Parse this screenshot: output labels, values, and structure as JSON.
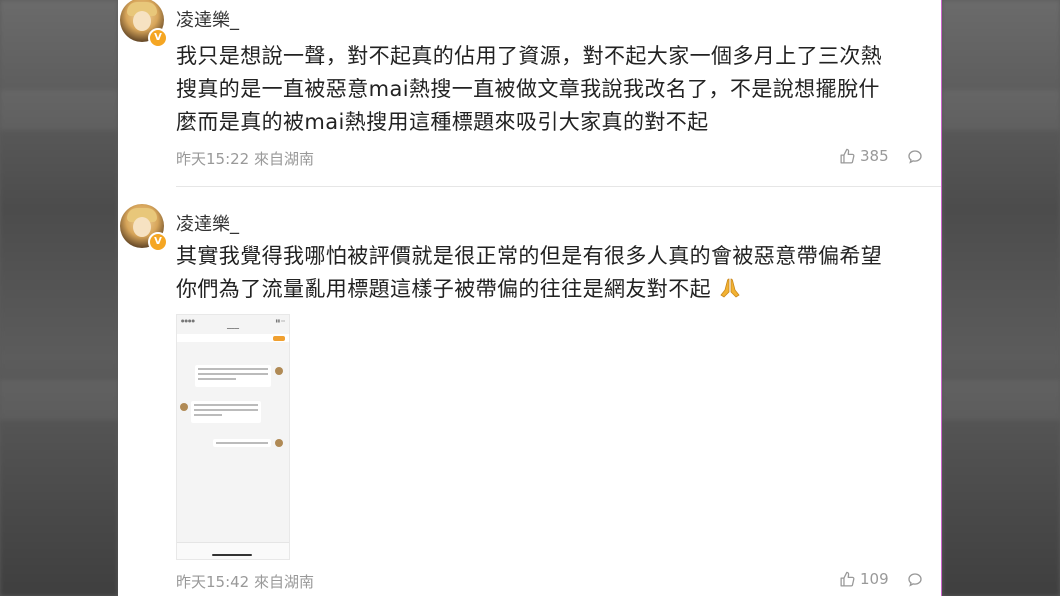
{
  "comments": [
    {
      "username": "凌達樂_",
      "text_lines": [
        "我只是想說一聲，對不起真的佔用了資源，對不起大家一個多月上了三次熱",
        "搜真的是一直被惡意mai熱搜一直被做文章我說我改名了，不是說想擺脫什",
        "麼而是真的被mai熱搜用這種標題來吸引大家真的對不起"
      ],
      "time": "昨天15:22",
      "source": "來自湖南",
      "likes": "385",
      "verified_badge": "V"
    },
    {
      "username": "凌達樂_",
      "text_lines": [
        "其實我覺得我哪怕被評價就是很正常的但是有很多人真的會被惡意帶偏希望",
        "你們為了流量亂用標題這樣子被帶偏的往往是網友對不起"
      ],
      "emoji": "pray-icon",
      "has_image": true,
      "time": "昨天15:42",
      "source": "來自湖南",
      "likes": "109",
      "verified_badge": "V"
    }
  ],
  "icons": {
    "like": "thumbs-up-icon",
    "comment": "comment-bubble-icon"
  },
  "colors": {
    "badge": "#f5a623",
    "meta_text": "#999999",
    "body_text": "#222222",
    "emoji": "#f2b233"
  }
}
